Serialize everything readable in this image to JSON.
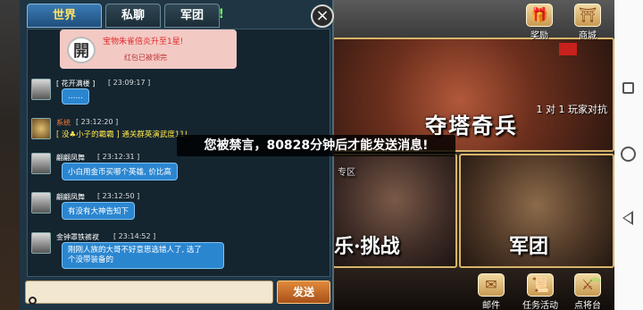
{
  "chat": {
    "tabs": [
      {
        "label": "世界"
      },
      {
        "label": "私聊"
      },
      {
        "label": "军团"
      }
    ],
    "tab_alert": "!",
    "close_icon": "×",
    "system_note": {
      "badge": "開",
      "line1": "宝物朱雀倍炎升至1星!",
      "line2": "红包已被领完"
    },
    "messages": [
      {
        "name": "[ 花开满楼 ]",
        "time": "[ 23:09:17 ]",
        "text": "……"
      },
      {
        "name": "系统",
        "time": "[ 23:12:20 ]",
        "text": "[ 没♣小子的霸霸 ] 通关群英演武度11!"
      },
      {
        "name": "翩翩凤舞",
        "time": "[ 23:12:31 ]",
        "text": "小白用金币买哪个英雄, 价比高"
      },
      {
        "name": "翩翩凤舞",
        "time": "[ 23:12:50 ]",
        "text": "有没有大神告知下"
      },
      {
        "name": "金钟罩铁裤衩",
        "time": "[ 23:14:52 ]",
        "text_line1": "刚刚人族的大哥不好意思选错人了, 选了",
        "text_line2": "个没带装备的"
      }
    ],
    "input_placeholder": "",
    "send_label": "发送"
  },
  "toast": {
    "text": "您被禁言，80828分钟后才能发送消息!"
  },
  "game": {
    "hud_top": [
      {
        "label": "奖励",
        "icon": "gift-icon"
      },
      {
        "label": "商城",
        "icon": "shop-icon"
      }
    ],
    "tower_title": "夺塔奇兵",
    "pvp_text": "1 对 1 玩家对抗",
    "left2_sub": "专区",
    "left2_title": "乐·挑战",
    "army_title": "军团",
    "hud_bottom": [
      {
        "label": "邮件",
        "icon": "mail-icon"
      },
      {
        "label": "任务活动",
        "icon": "task-icon"
      },
      {
        "label": "点将台",
        "icon": "general-icon"
      }
    ],
    "up_arrow": "︽"
  }
}
